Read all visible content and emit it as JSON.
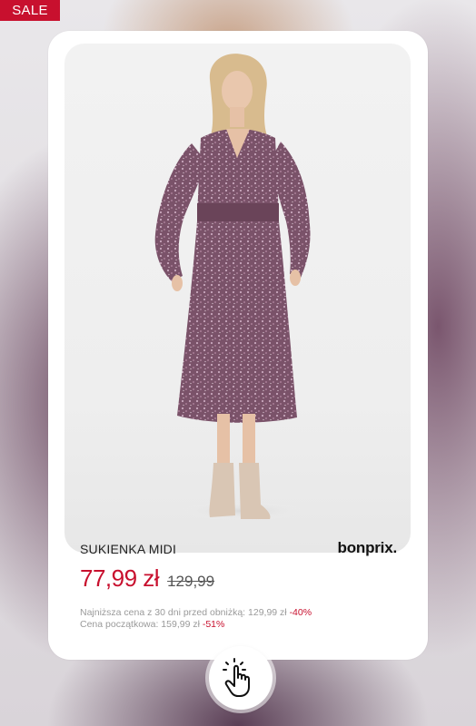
{
  "badge": {
    "label": "SALE",
    "color": "#c8102e"
  },
  "product": {
    "name": "SUKIENKA MIDI",
    "brand": "bonprix.",
    "price": "77,99 zł",
    "old_price": "129,99",
    "lowest_price_label": "Najniższa cena z 30 dni  przed obniżką: 129,99 zł",
    "lowest_price_discount": "-40%",
    "initial_price_label": "Cena początkowa: 159,99 zł",
    "initial_price_discount": "-51%",
    "image_icon": "dress-photo"
  },
  "cta": {
    "icon": "tap-hand-icon"
  }
}
